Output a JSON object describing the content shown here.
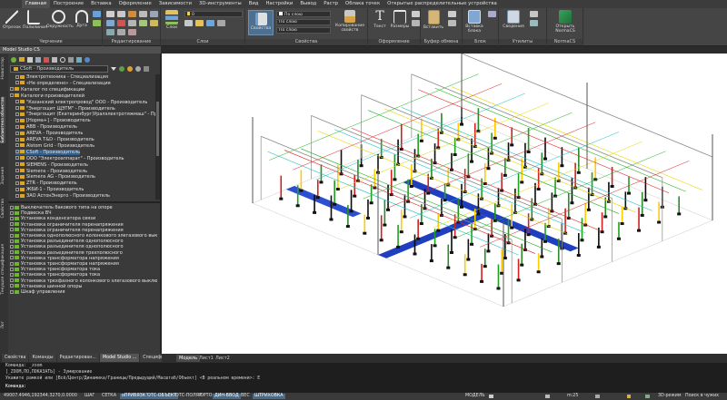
{
  "ribbon": {
    "tabs": [
      "Главная",
      "Построение",
      "Вставка",
      "Оформление",
      "Зависимости",
      "3D-инструменты",
      "Вид",
      "Настройки",
      "Вывод",
      "Растр",
      "Облака точек",
      "Открытые распределительные устройства"
    ],
    "active_tab": 0,
    "groups": {
      "drawing": {
        "label": "Черчение",
        "buttons": [
          "Отрезок",
          "Полилиния",
          "Окружность",
          "Дуга"
        ]
      },
      "edit": {
        "label": "Редактирование"
      },
      "layers": {
        "label": "Слои",
        "button": "Слои",
        "layer_value": "0"
      },
      "properties": {
        "label": "Свойства",
        "button": "Свойства",
        "color": "По слою",
        "linetype": "По слою",
        "lineweight": "По слою",
        "copy_props": "Копирование свойств"
      },
      "annotation": {
        "label": "Оформление",
        "buttons": [
          "Текст",
          "Размеры"
        ]
      },
      "clipboard": {
        "label": "Буфер обмена",
        "button": "Вставить"
      },
      "block": {
        "label": "Блок",
        "button": "Вставка блока"
      },
      "utilities": {
        "label": "Утилиты",
        "buttons": [
          "Сведения"
        ]
      },
      "normacs": {
        "label": "NormaCS",
        "button": "Открыть NormaCS"
      }
    }
  },
  "panel": {
    "title": "Model Studio CS",
    "producer_combo": "CSoft - Производитель",
    "side_tabs": [
      "Навигатор",
      "Библиотека объектов",
      "Задания",
      "Свойства",
      "Текущая спецификация",
      "Лог"
    ],
    "tree_top": [
      {
        "text": "Электротехника - Специализация",
        "level": 1,
        "sel": false
      },
      {
        "text": "«Не определено» - Специализация",
        "level": 1,
        "sel": false
      },
      {
        "text": "Каталог по спецификации",
        "level": 0,
        "sel": false
      },
      {
        "text": "Каталоги производителей",
        "level": 0,
        "sel": false
      },
      {
        "text": "\"Казанский электропровод\" ООО - Производитель",
        "level": 1,
        "sel": false
      },
      {
        "text": "\"Энергощит ЩЭТМ\" - Производитель",
        "level": 1,
        "sel": false
      },
      {
        "text": "\"Энергощит (Екатеринбург)Уралэлектротяжмаш\" - Произво",
        "level": 1,
        "sel": false
      },
      {
        "text": "[Норма+] - Производитель",
        "level": 1,
        "sel": false
      },
      {
        "text": "ABB - Производитель",
        "level": 1,
        "sel": false
      },
      {
        "text": "AREVA - Производитель",
        "level": 1,
        "sel": false
      },
      {
        "text": "AREVA T&D - Производитель",
        "level": 1,
        "sel": false
      },
      {
        "text": "Alstom Grid - Производитель",
        "level": 1,
        "sel": false
      },
      {
        "text": "CSoft - Производитель",
        "level": 1,
        "sel": true
      },
      {
        "text": "ООО \"Электроаппарат\" - Производитель",
        "level": 1,
        "sel": false
      },
      {
        "text": "SIEMENS - Производитель",
        "level": 1,
        "sel": false
      },
      {
        "text": "Siemens - Производитель",
        "level": 1,
        "sel": false
      },
      {
        "text": "Siemens AG - Производитель",
        "level": 1,
        "sel": false
      },
      {
        "text": "ZTR - Производитель",
        "level": 1,
        "sel": false
      },
      {
        "text": "ЖБИ-1 - Производитель",
        "level": 1,
        "sel": false
      },
      {
        "text": "ЗАО АстонЭнерго - Производитель",
        "level": 1,
        "sel": false
      }
    ],
    "tree_bottom": [
      "Выключатель бакового типа на опоре",
      "Подвеска ВЧ",
      "Установка конденсатора связи",
      "Установка ограничителя перенапряжения",
      "Установка ограничителя перенапряжения",
      "Установка однополюсного колонкового элегазового выключателя",
      "Установка разъединителя однополюсного",
      "Установка разъединителя однополюсного",
      "Установка разъединителя трехполюсного",
      "Установка трансформатора напряжения",
      "Установка трансформатора напряжения",
      "Установка трансформатора тока",
      "Установка трансформатора тока",
      "Установка трехфазного колонкового элегазового выключателя",
      "Установка шинной опоры",
      "Шкаф управления"
    ],
    "bottom_tabs": [
      "Свойства",
      "Команды",
      "Редактирован...",
      "Model Studio ...",
      "Спецификация"
    ],
    "bottom_active": 3
  },
  "viewport": {
    "tabs": [
      "Модель",
      "Лист1",
      "Лист2"
    ],
    "active": 0
  },
  "command": {
    "lines": [
      "Команда: _zoom",
      "[_ZOOM,ПО,ПОКАЗАТЬ] - Зумирование",
      "Укажите рамкой или [Всё/Центр/Динамика/Границы/Предыдущий/Масштаб/Объект] <В реальном времени>: E",
      "Команда:"
    ]
  },
  "status": {
    "coords": "49007.4946,192344.3270,0.0000",
    "toggles": [
      {
        "label": "ШАГ",
        "on": false
      },
      {
        "label": "СЕТКА",
        "on": false
      },
      {
        "label": "оПРИВЯЗКА",
        "on": true
      },
      {
        "label": "ОТС-ОБЪЕКТ",
        "on": true
      },
      {
        "label": "ОТС-ПОЛЯР",
        "on": false
      },
      {
        "label": "ОРТО",
        "on": false
      },
      {
        "label": "ДИН-ВВОД",
        "on": true
      },
      {
        "label": "ВЕС",
        "on": false
      },
      {
        "label": "ШТРИХОВКА",
        "on": true
      }
    ],
    "model": "МОДЕЛЬ",
    "scale": "m:25",
    "mode3d": "3D-режим",
    "search": "Поиск в чужих"
  },
  "colors": {
    "accent": "#2f5f8f",
    "viewport": "#ffffff",
    "ribbon": "#454545"
  }
}
